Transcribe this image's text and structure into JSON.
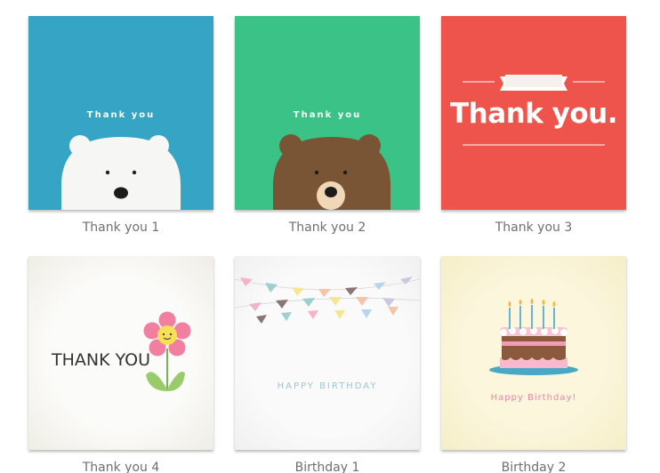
{
  "cards": [
    {
      "caption": "Thank you 1",
      "text": "Thank you"
    },
    {
      "caption": "Thank you 2",
      "text": "Thank you"
    },
    {
      "caption": "Thank you 3",
      "text": "Thank you."
    },
    {
      "caption": "Thank you 4",
      "text": "THANK YOU"
    },
    {
      "caption": "Birthday 1",
      "text": "HAPPY BIRTHDAY"
    },
    {
      "caption": "Birthday 2",
      "text": "Happy Birthday!"
    }
  ],
  "colors": {
    "blue": "#36a5c5",
    "green": "#3bc387",
    "red": "#ee544c",
    "bear_brown": "#7a5535"
  }
}
